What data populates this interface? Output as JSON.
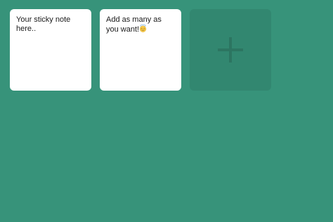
{
  "notes": [
    {
      "text": "Your sticky note here.."
    },
    {
      "text": "Add as many as you want!",
      "emoji": "smiling-face-with-halo"
    }
  ],
  "add_button": {
    "icon": "plus-icon"
  },
  "colors": {
    "background": "#37937a",
    "note": "#ffffff",
    "add_tile": "#338670",
    "plus": "#2c7561"
  }
}
